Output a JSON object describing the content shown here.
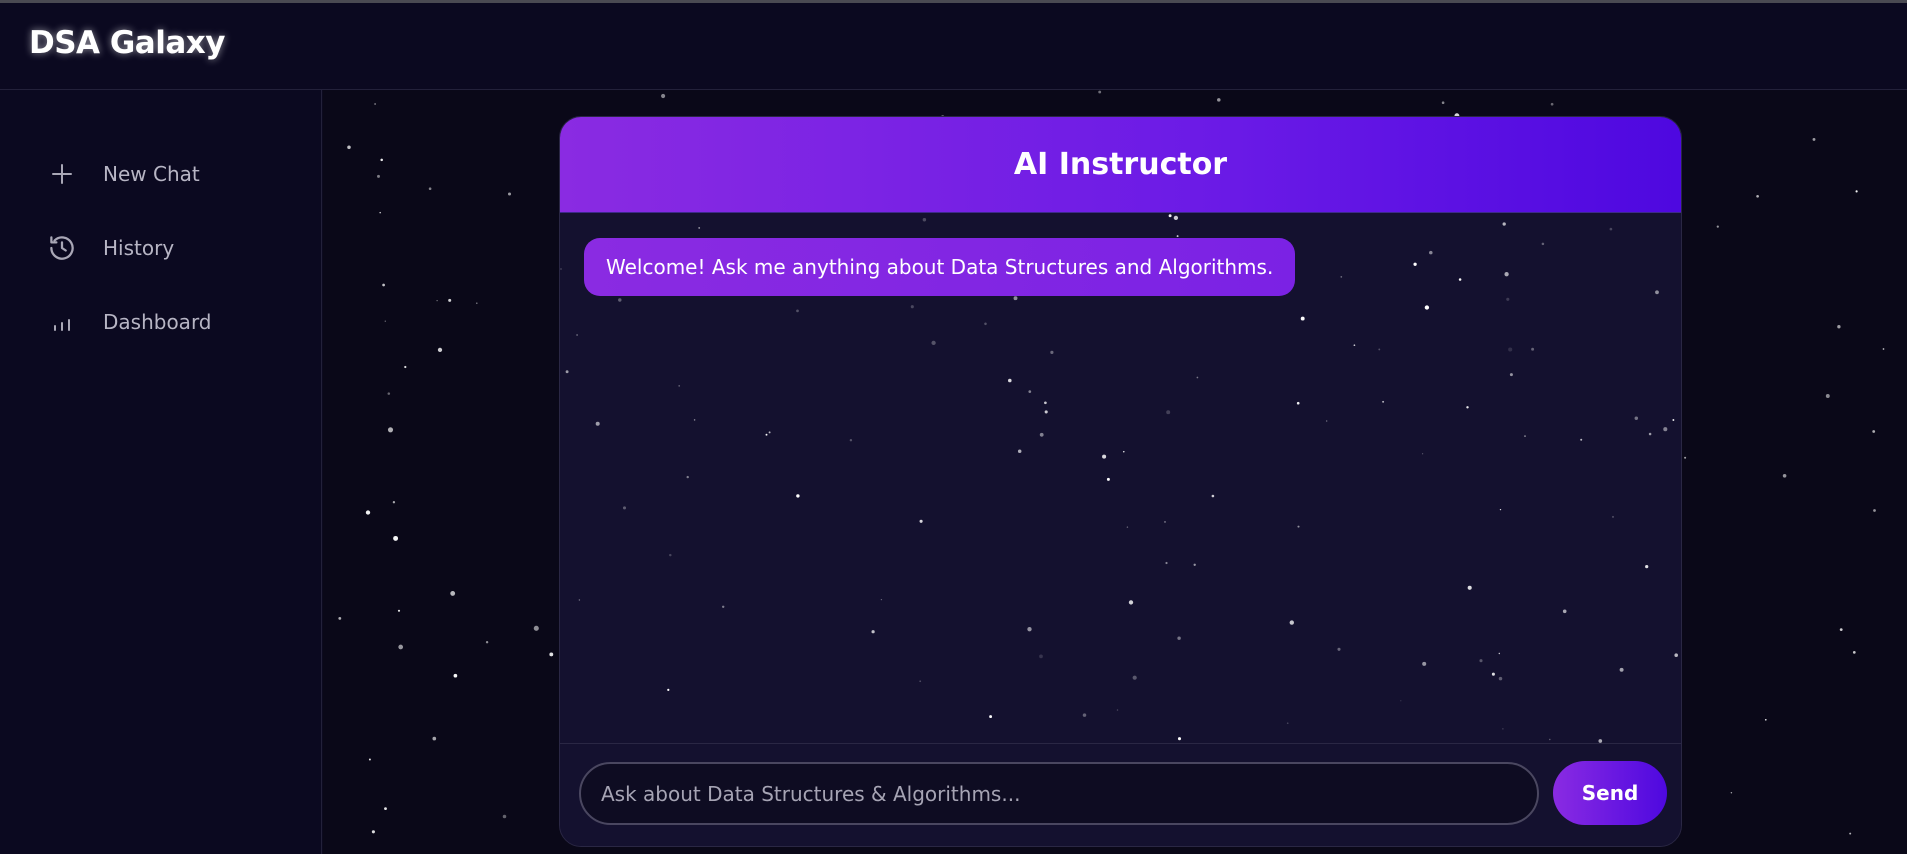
{
  "app": {
    "brand": "DSA Galaxy"
  },
  "sidebar": {
    "items": [
      {
        "label": "New Chat",
        "icon": "plus-icon"
      },
      {
        "label": "History",
        "icon": "history-icon"
      },
      {
        "label": "Dashboard",
        "icon": "bar-chart-icon"
      }
    ]
  },
  "chat": {
    "title": "AI Instructor",
    "messages": [
      {
        "role": "assistant",
        "text": "Welcome! Ask me anything about Data Structures and Algorithms."
      }
    ],
    "input": {
      "placeholder": "Ask about Data Structures & Algorithms...",
      "value": ""
    },
    "send_label": "Send"
  },
  "colors": {
    "background": "#0c0a1f",
    "accent_start": "#8a2be2",
    "accent_end": "#4e08e0",
    "panel": "#14112f"
  }
}
